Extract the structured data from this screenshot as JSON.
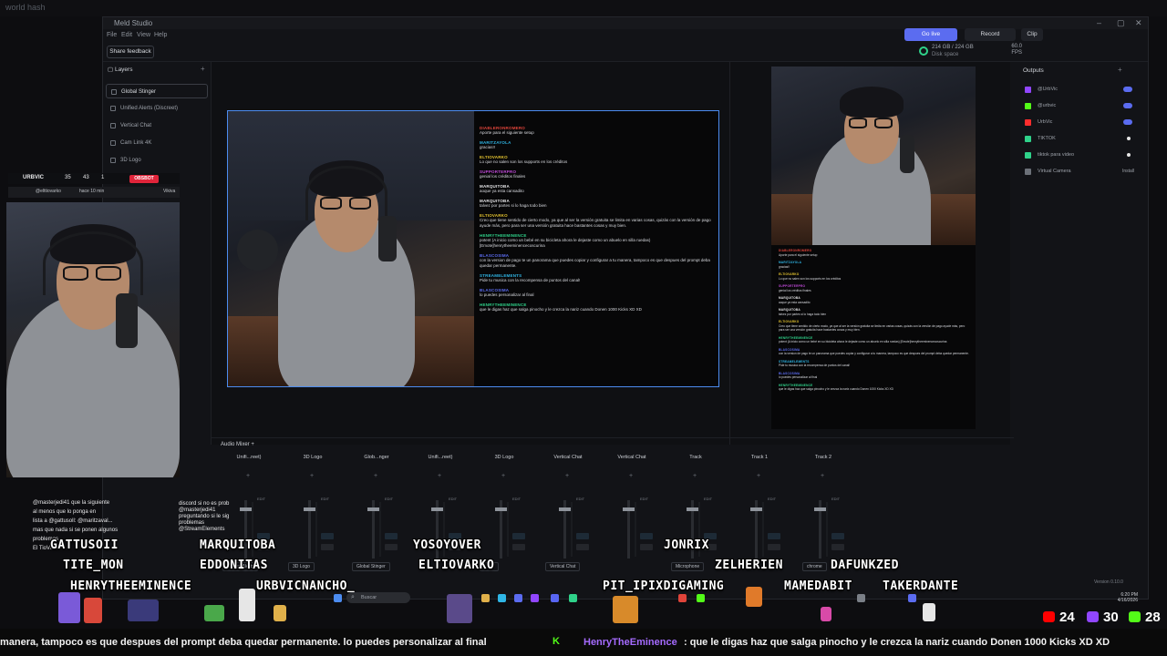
{
  "desktop": {
    "tab_title": "world hash"
  },
  "app": {
    "title": "Meld Studio",
    "menu": [
      "File",
      "Edit",
      "View",
      "Help"
    ],
    "share_feedback": "Share feedback",
    "disk_value": "214 GB / 224 GB",
    "disk_label": "Disk space",
    "fps_value": "60.0",
    "fps_label": "FPS",
    "go_live": "Go live",
    "record": "Record",
    "clip": "Clip",
    "version": "Version 0.10.0"
  },
  "layers": {
    "header": "Layers",
    "items": [
      "Global Stinger",
      "Unified Alerts (Discreet)",
      "Vertical Chat",
      "Cam Link 4K",
      "3D Logo"
    ]
  },
  "outputs": {
    "header": "Outputs",
    "items": [
      {
        "label": "@UrbVic",
        "color": "#9146ff",
        "state": "toggle"
      },
      {
        "label": "@urbvic",
        "color": "#53fc18",
        "state": "toggle"
      },
      {
        "label": "UrbVic",
        "color": "#ff2d2d",
        "state": "toggle"
      },
      {
        "label": "TIKTOK",
        "color": "#2fd28a",
        "state": "dot"
      },
      {
        "label": "tiktok para video",
        "color": "#2fd28a",
        "state": "dot"
      },
      {
        "label": "Virtual Camera",
        "color": "#6c7179",
        "state": "install",
        "install": "Install"
      }
    ]
  },
  "chat": [
    {
      "user": "DIABLERONROMERO",
      "color": "#e0443a",
      "msg": "Aporte para el siguiente setup"
    },
    {
      "user": "MARITZAYOLA",
      "color": "#2fb6e6",
      "msg": "gracias!!"
    },
    {
      "user": "ELTIOVARKO",
      "color": "#e6c52f",
      "msg": "Lo que no salen son los supports en los créditos"
    },
    {
      "user": "SUPPORTERPRO",
      "color": "#c04ad8",
      "msg": "genial los créditos finales"
    },
    {
      "user": "MARQUITOBA",
      "color": "#e7e7e9",
      "msg": "aoque ya esta cansadito"
    },
    {
      "user": "MARQUITOBA",
      "color": "#e7e7e9",
      "msg": "talvez por partes si lo haga todo bien"
    },
    {
      "user": "ELTIOVARKO",
      "color": "#e6c52f",
      "msg": "Creo que tiene sentido de cierto modo, ya que al ser la versión gratuita se limita en varias cosas, quizás con la versión de pago ayude más, pero para ser una versión gratuita hace bastantes cosas y muy bien."
    },
    {
      "user": "HENRYTHEEMINENCE",
      "color": "#2fd28a",
      "msg": "potent (A inicio como un bebé en su bicicleta ahora le dejaste como un abuelo en silla ruedas) [Emote]henrytheeminencecoscurina"
    },
    {
      "user": "BLASCOSIMA",
      "color": "#5b6cf0",
      "msg": "con la version de pago te un panorama que puedes copiar y configurar a tu manera, tampoco es que despues del prompt deba quedar permanente."
    },
    {
      "user": "STREAMELEMENTS",
      "color": "#2fb6e6",
      "msg": "Pide tu musica con la recompensa de puntos del canal!"
    },
    {
      "user": "BLASCOSIMA",
      "color": "#5b6cf0",
      "msg": "lo puedes personalizar al final"
    },
    {
      "user": "HENRYTHEEMINENCE",
      "color": "#2fd28a",
      "msg": "que le digas haz que salga pinocho y le crezca la nariz cuando Donen 1000 Kicks XD XD"
    }
  ],
  "mixer": {
    "header": "Audio Mixer",
    "tracks": [
      "Unifi...reet)",
      "3D Logo",
      "Glob...nger",
      "Unifi...reet)",
      "3D Logo",
      "Vertical Chat",
      "Vertical Chat",
      "Track",
      "Track 1",
      "Track 2"
    ],
    "edit": "EDIT",
    "cue": "CUE",
    "mute": "MUTE",
    "sources": [
      "Unified Alerts",
      "3D Logo",
      "Global Stinger",
      "Logo",
      "Vertical Chat",
      "Microphone",
      "chrome"
    ]
  },
  "overlay": {
    "name": "URBVIC",
    "c1": "35",
    "c2": "43",
    "c3": "1",
    "obsbot": "OBSBOT",
    "sub_user": "@elttiovarko",
    "sub_time": "hace 10 min",
    "sub_right": "Vikiva",
    "chat_lines": [
      "@masterjedi41 que la siguiente",
      "al menos que lo ponga en",
      "lista a @gattusoll: @maritzaval...",
      "mas que nada si se ponen algunos",
      "problemas",
      "El TioVarko"
    ],
    "chat2_lines": [
      "discord si no es prob",
      "@masterjedi41",
      "preguntando si le sig",
      "problemas",
      "@StreamElements"
    ]
  },
  "viewers": [
    "GATTUSOII",
    "MARQUITOBA",
    "YOSOYOVER",
    "JONRIX",
    "TITE_MON",
    "EDDONITAS",
    "ELTIOVARKO",
    "ZELHERIEN",
    "DAFUNKZED",
    "HENRYTHEEMINENCE",
    "URBVICNANCHO_",
    "PIT_IPIXDIGAMING",
    "MAMEDABIT",
    "TAKERDANTE"
  ],
  "taskbar": {
    "search_placeholder": "Buscar",
    "time": "6:20 PM",
    "date": "4/16/2026"
  },
  "ticker": {
    "lead": "manera, tampoco es que despues del prompt deba quedar permanente.  lo puedes personalizar al final",
    "user": "HenryTheEminence",
    "msg": ":  que le digas haz que salga pinocho y le crezca la nariz cuando Donen 1000 Kicks XD XD"
  },
  "counts": {
    "youtube": "24",
    "twitch": "30",
    "kick": "28"
  }
}
